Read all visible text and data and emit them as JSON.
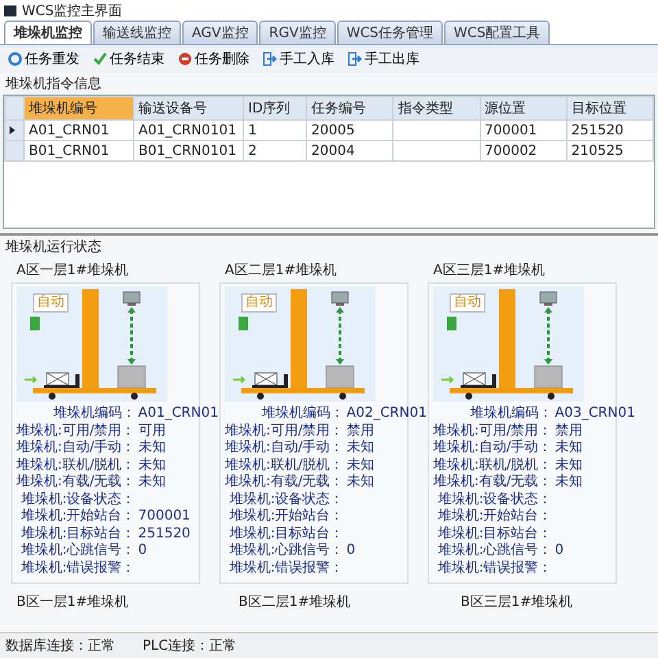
{
  "window": {
    "title": "WCS监控主界面"
  },
  "tabs": [
    {
      "label": "堆垛机监控",
      "selected": true
    },
    {
      "label": "输送线监控",
      "selected": false
    },
    {
      "label": "AGV监控",
      "selected": false
    },
    {
      "label": "RGV监控",
      "selected": false
    },
    {
      "label": "WCS任务管理",
      "selected": false
    },
    {
      "label": "WCS配置工具",
      "selected": false
    }
  ],
  "toolbar": [
    {
      "label": "任务重发",
      "kind": "resend"
    },
    {
      "label": "任务结束",
      "kind": "finish"
    },
    {
      "label": "任务删除",
      "kind": "delete"
    },
    {
      "label": "手工入库",
      "kind": "inbound"
    },
    {
      "label": "手工出库",
      "kind": "outbound"
    }
  ],
  "command_section": {
    "title": "堆垛机指令信息"
  },
  "table": {
    "columns": [
      {
        "label": "堆垛机编号",
        "selected": true
      },
      {
        "label": "输送设备号",
        "selected": false
      },
      {
        "label": "ID序列",
        "selected": false
      },
      {
        "label": "任务编号",
        "selected": false
      },
      {
        "label": "指令类型",
        "selected": false
      },
      {
        "label": "源位置",
        "selected": false
      },
      {
        "label": "目标位置",
        "selected": false
      }
    ],
    "rows": [
      {
        "selected": true,
        "cells": [
          "A01_CRN01",
          "A01_CRN0101",
          "1",
          "20005",
          "",
          "700001",
          "251520"
        ]
      },
      {
        "selected": false,
        "cells": [
          "B01_CRN01",
          "B01_CRN0101",
          "2",
          "20004",
          "",
          "700002",
          "210525"
        ]
      }
    ]
  },
  "status_section": {
    "title": "堆垛机运行状态",
    "cards": [
      {
        "title": "A区一层1#堆垛机",
        "mode": "自动",
        "info": [
          {
            "label": "堆垛机编码：",
            "value": "A01_CRN01"
          },
          {
            "label": "堆垛机:可用/禁用：",
            "value": "可用"
          },
          {
            "label": "堆垛机:自动/手动：",
            "value": "未知"
          },
          {
            "label": "堆垛机:联机/脱机：",
            "value": "未知"
          },
          {
            "label": "堆垛机:有载/无载：",
            "value": "未知"
          },
          {
            "label": "堆垛机:设备状态："
          },
          {
            "label": "堆垛机:开始站台：",
            "value": "700001"
          },
          {
            "label": "堆垛机:目标站台：",
            "value": "251520"
          },
          {
            "label": "堆垛机:心跳信号：",
            "value": "0"
          },
          {
            "label": "堆垛机:错误报警："
          }
        ]
      },
      {
        "title": "A区二层1#堆垛机",
        "mode": "自动",
        "info": [
          {
            "label": "堆垛机编码：",
            "value": "A02_CRN01"
          },
          {
            "label": "堆垛机:可用/禁用：",
            "value": "禁用"
          },
          {
            "label": "堆垛机:自动/手动：",
            "value": "未知"
          },
          {
            "label": "堆垛机:联机/脱机：",
            "value": "未知"
          },
          {
            "label": "堆垛机:有载/无载：",
            "value": "未知"
          },
          {
            "label": "堆垛机:设备状态："
          },
          {
            "label": "堆垛机:开始站台："
          },
          {
            "label": "堆垛机:目标站台："
          },
          {
            "label": "堆垛机:心跳信号：",
            "value": "0"
          },
          {
            "label": "堆垛机:错误报警："
          }
        ]
      },
      {
        "title": "A区三层1#堆垛机",
        "mode": "自动",
        "info": [
          {
            "label": "堆垛机编码：",
            "value": "A03_CRN01"
          },
          {
            "label": "堆垛机:可用/禁用：",
            "value": "禁用"
          },
          {
            "label": "堆垛机:自动/手动：",
            "value": "未知"
          },
          {
            "label": "堆垛机:联机/脱机：",
            "value": "未知"
          },
          {
            "label": "堆垛机:有载/无载：",
            "value": "未知"
          },
          {
            "label": "堆垛机:设备状态："
          },
          {
            "label": "堆垛机:开始站台："
          },
          {
            "label": "堆垛机:目标站台："
          },
          {
            "label": "堆垛机:心跳信号：",
            "value": "0"
          },
          {
            "label": "堆垛机:错误报警："
          }
        ]
      }
    ],
    "next_row_titles": [
      "B区一层1#堆垛机",
      "B区二层1#堆垛机",
      "B区三层1#堆垛机"
    ]
  },
  "status_bar": [
    {
      "label": "数据库连接：",
      "value": "正常"
    },
    {
      "label": "PLC连接：",
      "value": "正常"
    }
  ]
}
